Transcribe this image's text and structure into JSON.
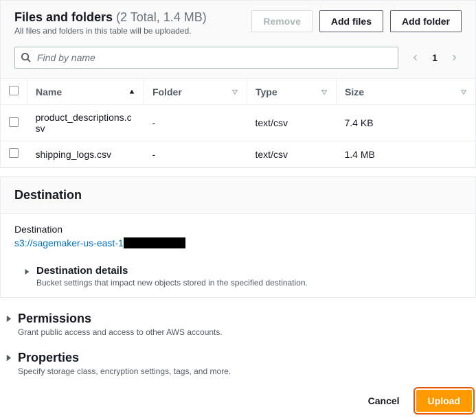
{
  "filesPanel": {
    "title": "Files and folders",
    "countText": "(2 Total, 1.4 MB)",
    "subtitle": "All files and folders in this table will be uploaded.",
    "actions": {
      "remove": "Remove",
      "addFiles": "Add files",
      "addFolder": "Add folder"
    },
    "search": {
      "placeholder": "Find by name"
    },
    "pager": {
      "current": "1"
    },
    "columns": {
      "name": "Name",
      "folder": "Folder",
      "type": "Type",
      "size": "Size"
    },
    "rows": [
      {
        "name": "product_descriptions.csv",
        "folder": "-",
        "type": "text/csv",
        "size": "7.4 KB"
      },
      {
        "name": "shipping_logs.csv",
        "folder": "-",
        "type": "text/csv",
        "size": "1.4 MB"
      }
    ]
  },
  "destinationPanel": {
    "title": "Destination",
    "label": "Destination",
    "uriVisible": "s3://sagemaker-us-east-1",
    "details": {
      "title": "Destination details",
      "subtitle": "Bucket settings that impact new objects stored in the specified destination."
    }
  },
  "permissions": {
    "title": "Permissions",
    "subtitle": "Grant public access and access to other AWS accounts."
  },
  "properties": {
    "title": "Properties",
    "subtitle": "Specify storage class, encryption settings, tags, and more."
  },
  "footer": {
    "cancel": "Cancel",
    "upload": "Upload"
  }
}
